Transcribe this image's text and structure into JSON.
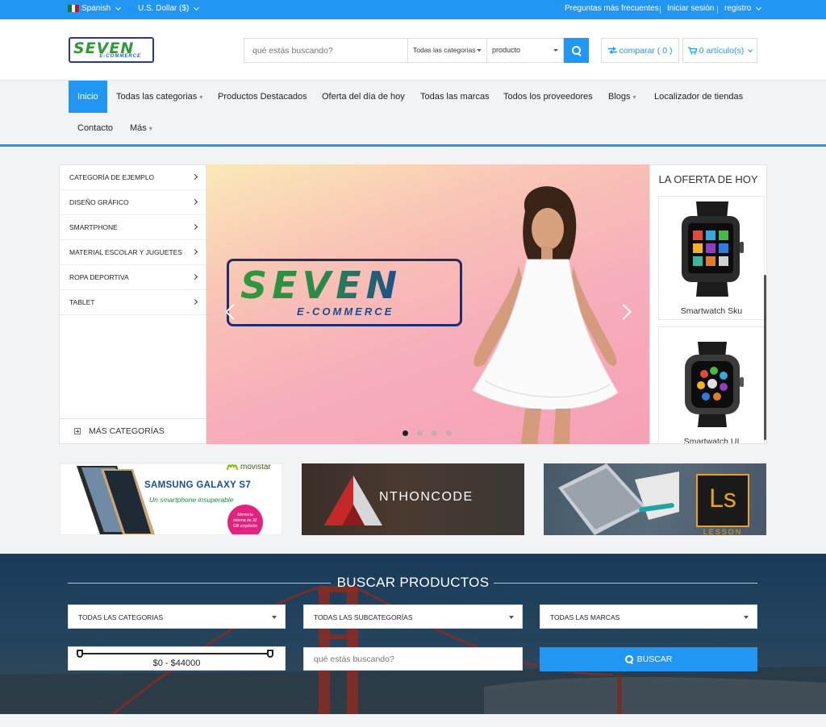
{
  "topbar": {
    "language": "Spanish",
    "currency": "U.S. Dollar ($)",
    "faq": "Preguntas más frecuentes",
    "login": "Iniciar sesión",
    "register": "registro"
  },
  "header": {
    "logo_text": "SEVEN",
    "logo_sub": "E-COMMERCE",
    "search_placeholder": "qué estás buscando?",
    "category_select": "Todas las categorias",
    "type_select": "producto",
    "compare_label": "comparar ( 0 )",
    "cart_label": "0 artículo(s)"
  },
  "nav": {
    "items": [
      {
        "label": "Inicio"
      },
      {
        "label": "Todas las categorias"
      },
      {
        "label": "Productos Destacados"
      },
      {
        "label": "Oferta del día de hoy"
      },
      {
        "label": "Todas las marcas"
      },
      {
        "label": "Todos los proveedores"
      },
      {
        "label": "Blogs"
      },
      {
        "label": "Localizador de tiendas"
      },
      {
        "label": "Contacto"
      },
      {
        "label": "Más"
      }
    ]
  },
  "categories": {
    "items": [
      {
        "label": "Categoría de ejemplo"
      },
      {
        "label": "Diseño gráfico"
      },
      {
        "label": "Smartphone"
      },
      {
        "label": "Material escolar y juguetes"
      },
      {
        "label": "Ropa deportiva"
      },
      {
        "label": "Tablet"
      }
    ],
    "more_label": "MÁS CATEGORÍAS"
  },
  "slider": {
    "logo_text": "SEVEN",
    "logo_sub": "E-COMMERCE",
    "dots": 4
  },
  "offer": {
    "title": "LA OFERTA DE HOY",
    "products": [
      {
        "name": "Smartwatch Sku"
      },
      {
        "name": "Smartwatch UI"
      }
    ]
  },
  "banners": {
    "samsung_brand": "movistar",
    "samsung_title": "SAMSUNG GALAXY S7",
    "samsung_subtitle": "Un smartphone insuperable",
    "samsung_badge": "Memoria interna de 32 GB ampliable",
    "anthon_text": "NTHONCODE",
    "anthon_letter": "A",
    "lesson_logo": "Ls",
    "lesson_text": "LESSON"
  },
  "search_section": {
    "title": "BUSCAR PRODUCTOS",
    "category": "Todas las categorias",
    "subcategory": "Todas las subcategorías",
    "brand": "Todas las marcas",
    "price_range": "$0 - $44000",
    "search_placeholder": "qué estás buscando?",
    "search_button": "BUSCAR"
  },
  "colors": {
    "accent": "#2196f3",
    "logo_green": "#2e9a3a",
    "logo_navy": "#1f2d6e"
  }
}
